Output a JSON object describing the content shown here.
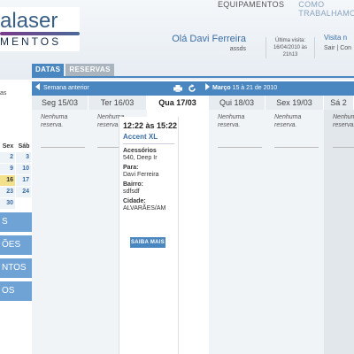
{
  "brand": {
    "logo_main": "alaser",
    "logo_sub": "MENTOS"
  },
  "topnav": {
    "items": [
      "EQUIPAMENTOS",
      "COMO TRABALHAMOS"
    ]
  },
  "user": {
    "greeting": "Olá Davi Ferreira",
    "username": "assds"
  },
  "last_visit": {
    "label": "Última visita:",
    "date": "16/04/2010 às",
    "time": "21h13"
  },
  "user_links": {
    "visit": "Visita n",
    "sair": "Sair",
    "sep": "|",
    "conta": "Con"
  },
  "tabs": [
    "DATAS",
    "RESERVAS"
  ],
  "sidebar": {
    "partial_text": "as",
    "calendar": {
      "headers": [
        "Sex",
        "Sáb"
      ],
      "rows": [
        [
          "2",
          "3"
        ],
        [
          "9",
          "10"
        ],
        [
          "16",
          "17"
        ],
        [
          "23",
          "24"
        ],
        [
          "30",
          ""
        ]
      ],
      "today": "16"
    },
    "menu": [
      "S",
      "ÕES",
      "NTOS",
      "OS"
    ]
  },
  "weekbar": {
    "prev": "Semana anterior",
    "month": "Março",
    "range": " 15 à 21 de 2010"
  },
  "days": [
    {
      "label": "Seg 15/03",
      "note": "Nenhuma reserva."
    },
    {
      "label": "Ter 16/03",
      "note": "Nenhuma reserva."
    },
    {
      "label": "Qua 17/03",
      "note": ""
    },
    {
      "label": "Qui 18/03",
      "note": "Nenhuma reserva."
    },
    {
      "label": "Sex 19/03",
      "note": "Nenhuma reserva."
    },
    {
      "label": "Sá 2",
      "note": "Nenhuma reserva."
    }
  ],
  "reservation": {
    "time": "12:22 às 15:22",
    "title": "Accent XL",
    "acessorios_label": "Acessórios",
    "acessorios_value": "540, Deep Ir",
    "para_label": "Para:",
    "para_value": "Davi Ferreira",
    "bairro_label": "Bairro:",
    "bairro_value": "sdfsdf",
    "cidade_label": "Cidade:",
    "cidade_value": "ALVARÃES/AM",
    "button": "SAIBA MAIS"
  },
  "colors": {
    "accent": "#4a86bf",
    "link": "#3a6ea5",
    "today": "#f3e08a",
    "menu_button": "#6fa3d6"
  }
}
